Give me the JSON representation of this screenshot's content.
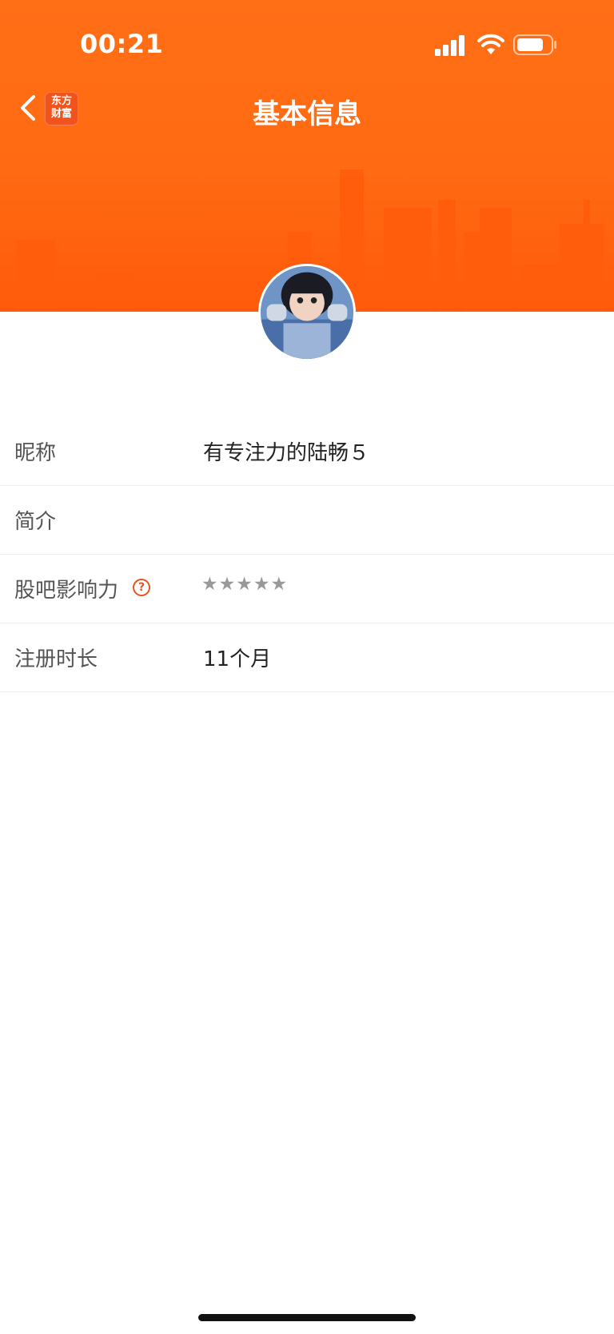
{
  "status_bar": {
    "time": "00:21"
  },
  "nav": {
    "title": "基本信息",
    "app_logo_line1": "东方",
    "app_logo_line2": "财富"
  },
  "profile": {
    "rows": [
      {
        "label": "昵称",
        "value": "有专注力的陆畅５"
      },
      {
        "label": "简介",
        "value": ""
      },
      {
        "label": "股吧影响力",
        "value": "★★★★★",
        "help_icon": "question-circle-icon",
        "stars_rating": 0
      },
      {
        "label": "注册时长",
        "value": "11个月"
      }
    ]
  },
  "colors": {
    "header_orange": "#ff6a12",
    "accent": "#e8541b",
    "star_gray": "#999999"
  }
}
